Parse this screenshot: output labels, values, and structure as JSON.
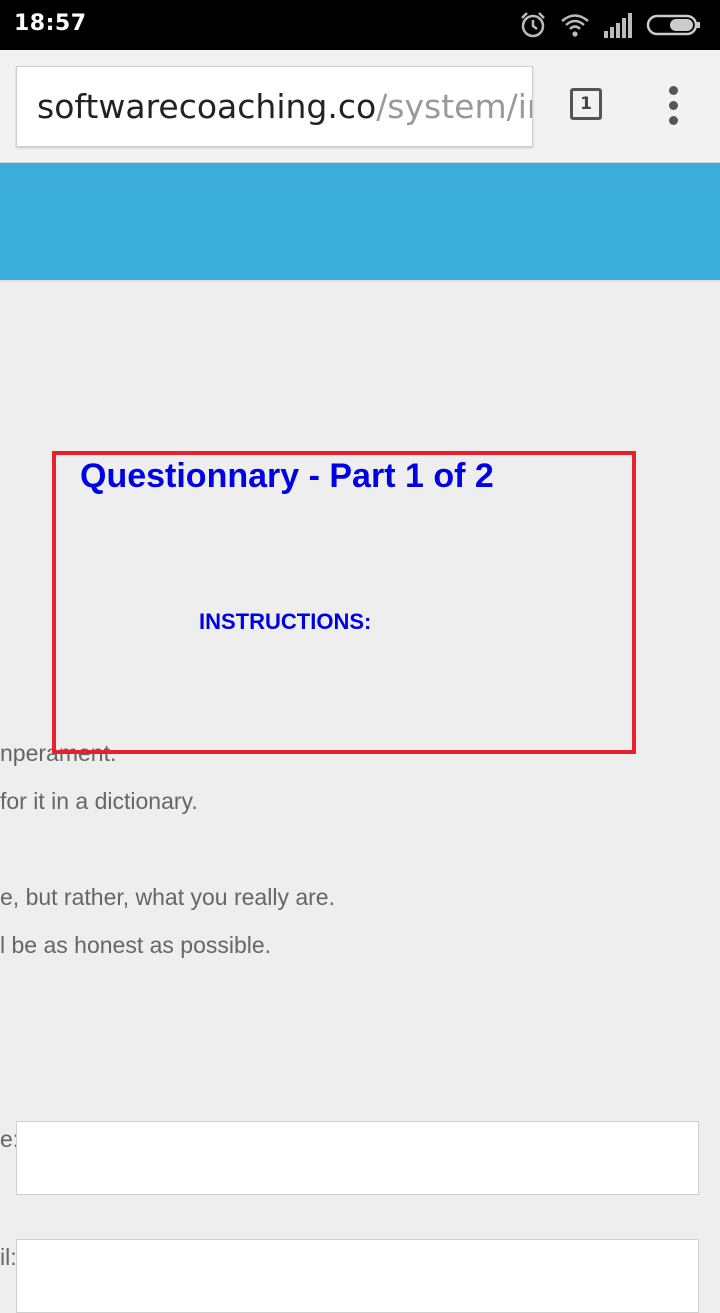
{
  "status_bar": {
    "time": "18:57",
    "icons": [
      "alarm-icon",
      "wifi-icon",
      "signal-icon",
      "battery-icon"
    ]
  },
  "browser": {
    "url_host": "softwarecoaching.co",
    "url_path": "/system/ir",
    "tab_count": "1"
  },
  "colors": {
    "header_band": "#3aaddb",
    "title": "#0000e6",
    "highlight_border": "#e8202a"
  },
  "content": {
    "title": "Questionnary - Part 1 of 2",
    "instructions_heading": "INSTRUCTIONS:",
    "instructions_lines": [
      "nperament.",
      "for it in a dictionary.",
      "e, but rather, what you really are.",
      "l be as honest as possible."
    ],
    "fields": [
      {
        "label": "e:",
        "value": ""
      },
      {
        "label": "il:",
        "value": ""
      }
    ]
  }
}
